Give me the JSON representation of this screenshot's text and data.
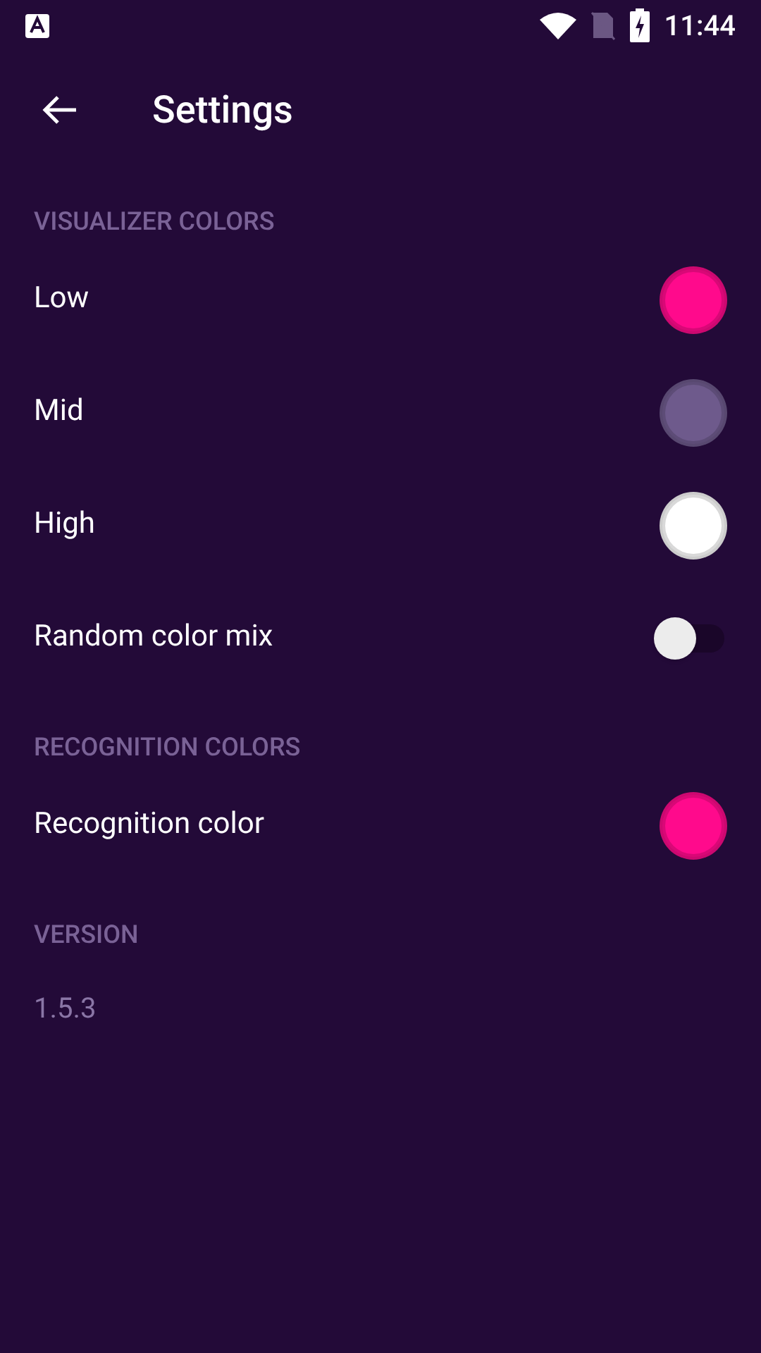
{
  "status_bar": {
    "time": "11:44"
  },
  "toolbar": {
    "title": "Settings"
  },
  "sections": [
    {
      "title": "VISUALIZER COLORS",
      "items": [
        {
          "kind": "swatch",
          "label": "Low",
          "color": "#ff0a8c"
        },
        {
          "kind": "swatch",
          "label": "Mid",
          "color": "#6e5a8c"
        },
        {
          "kind": "swatch",
          "label": "High",
          "color": "#ffffff"
        },
        {
          "kind": "switch",
          "label": "Random color mix",
          "on": false
        }
      ]
    },
    {
      "title": "RECOGNITION COLORS",
      "items": [
        {
          "kind": "swatch",
          "label": "Recognition color",
          "color": "#ff0a8c"
        }
      ]
    },
    {
      "title": "VERSION",
      "items": [
        {
          "kind": "text",
          "label": "1.5.3"
        }
      ]
    }
  ]
}
